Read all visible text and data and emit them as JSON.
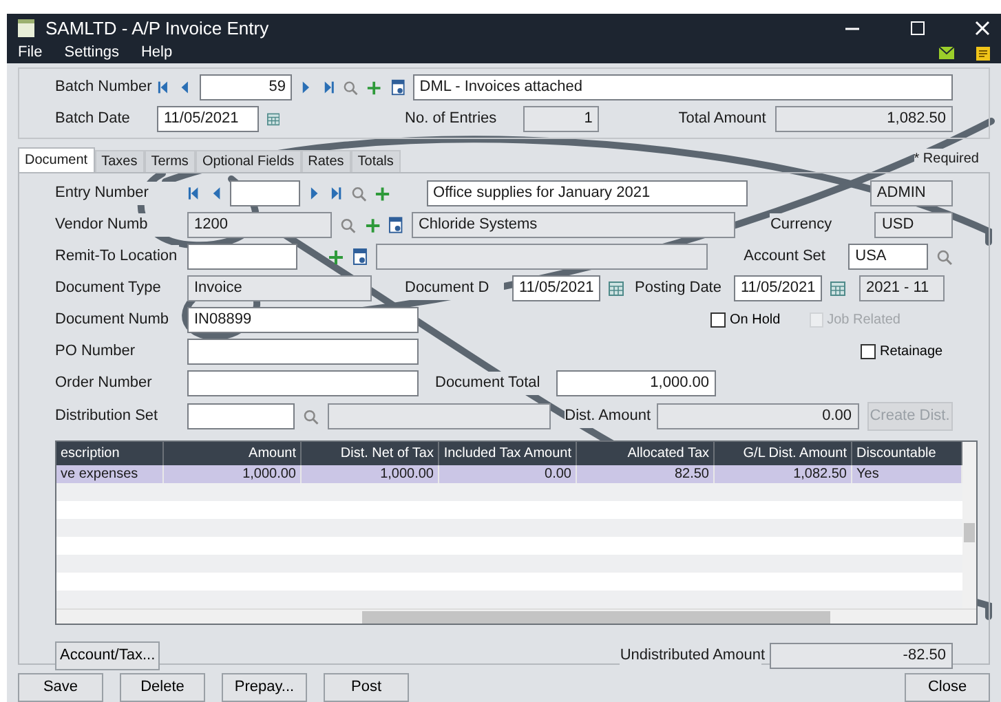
{
  "window": {
    "title": "SAMLTD - A/P Invoice Entry"
  },
  "menu": [
    "File",
    "Settings",
    "Help"
  ],
  "batch": {
    "number_label": "Batch Number",
    "number": "59",
    "description": "DML - Invoices attached",
    "date_label": "Batch Date",
    "date": "11/05/2021",
    "entries_label": "No. of Entries",
    "entries": "1",
    "total_label": "Total Amount",
    "total": "1,082.50"
  },
  "tabs": [
    {
      "label": "Document",
      "selected": true
    },
    {
      "label": "Taxes",
      "selected": false
    },
    {
      "label": "Terms",
      "selected": false
    },
    {
      "label": "Optional Fields",
      "selected": false
    },
    {
      "label": "Rates",
      "selected": false
    },
    {
      "label": "Totals",
      "selected": false
    }
  ],
  "required_note": "* Required",
  "document": {
    "entry_label": "Entry Number",
    "entry_description": "Office supplies for January 2021",
    "entered_by": "ADMIN",
    "vendor_label": "Vendor Numb",
    "vendor": "1200",
    "vendor_name": "Chloride Systems",
    "currency_label": "Currency",
    "currency": "USD",
    "remit_label": "Remit-To Location",
    "account_set_label": "Account Set",
    "account_set": "USA",
    "doc_type_label": "Document Type",
    "doc_type": "Invoice",
    "doc_date_label": "Document D",
    "doc_date": "11/05/2021",
    "posting_label": "Posting Date",
    "posting_date": "11/05/2021",
    "period": "2021 - 11",
    "doc_number_label": "Document Numb",
    "doc_number": "IN08899",
    "checks": [
      {
        "label": "On Hold",
        "checked": false,
        "disabled": false
      },
      {
        "label": "Job Related",
        "checked": false,
        "disabled": true
      },
      {
        "label": "Retainage",
        "checked": false,
        "disabled": false
      }
    ],
    "po_label": "PO Number",
    "order_label": "Order Number",
    "doc_total_label": "Document Total",
    "doc_total": "1,000.00",
    "dist_set_label": "Distribution Set",
    "dist_amount_label": "Dist. Amount",
    "dist_amount": "0.00",
    "create_dist": {
      "label": "Create Dist.",
      "disabled": true
    }
  },
  "table": {
    "columns": [
      "escription",
      "Amount",
      "Dist. Net of Tax",
      "Included Tax Amount",
      "Allocated Tax",
      "G/L Dist. Amount",
      "Discountable"
    ],
    "rows": [
      {
        "cells": [
          "ve expenses",
          "1,000.00",
          "1,000.00",
          "0.00",
          "82.50",
          "1,082.50",
          "Yes"
        ],
        "selected": true
      }
    ]
  },
  "account_tax_button": "Account/Tax...",
  "undistributed_label": "Undistributed Amount",
  "undistributed": "-82.50",
  "buttons": [
    "Save",
    "Delete",
    "Prepay...",
    "Post"
  ],
  "close_button": "Close"
}
